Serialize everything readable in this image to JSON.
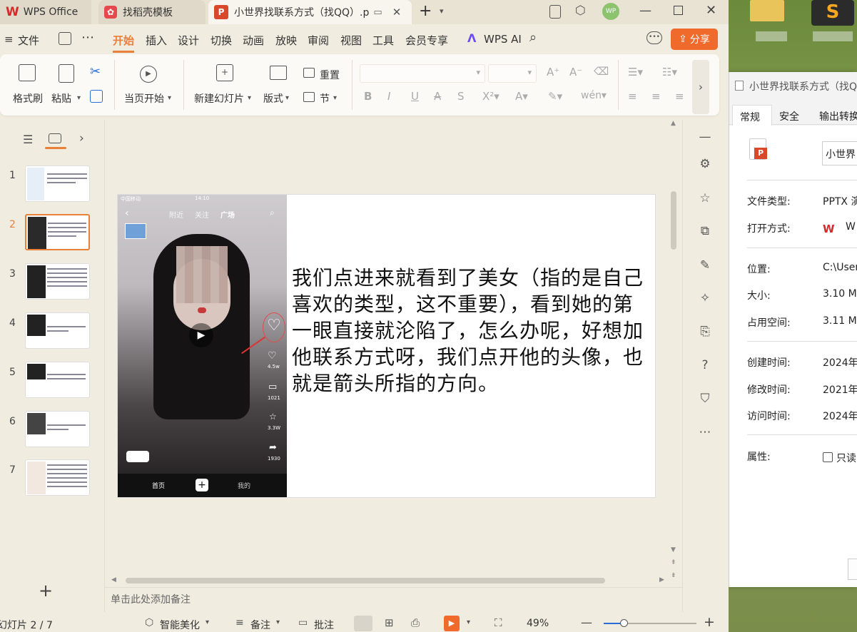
{
  "tabs": [
    {
      "label": "WPS Office"
    },
    {
      "label": "找稻壳模板"
    },
    {
      "label": "小世界找联系方式（找QQ）.p"
    }
  ],
  "window_controls": {
    "avatar": "WP"
  },
  "menu": {
    "file": "文件",
    "items": [
      "开始",
      "插入",
      "设计",
      "切换",
      "动画",
      "放映",
      "审阅",
      "视图",
      "工具",
      "会员专享"
    ],
    "active": "开始",
    "wps_ai": "WPS AI",
    "share": "分享"
  },
  "ribbon": {
    "format_painter": "格式刷",
    "paste": "粘贴",
    "play_from_current": "当页开始",
    "new_slide": "新建幻灯片",
    "layout": "版式",
    "reset": "重置",
    "section": "节"
  },
  "slides_panel": {
    "numbers": [
      "1",
      "2",
      "3",
      "4",
      "5",
      "6",
      "7"
    ],
    "selected": "2"
  },
  "slide": {
    "text": "我们点进来就看到了美女（指的是自己喜欢的类型，这不重要），看到她的第一眼直接就沦陷了，怎么办呢，好想加他联系方式呀，我们点开他的头像，也就是箭头所指的方向。",
    "phone": {
      "carrier": "中国移动",
      "time": "14:10",
      "tab_nearby": "附近",
      "tab_follow": "关注",
      "tab_square": "广场",
      "like_count": "4.5w",
      "comment_count": "1021",
      "star_count": "3.3W",
      "share_count": "1930",
      "nav_home": "首页",
      "nav_me": "我的"
    }
  },
  "notes_placeholder": "单击此处添加备注",
  "status": {
    "slide_info": "幻灯片 2 / 7",
    "smart_beautify": "智能美化",
    "notes": "备注",
    "comments": "批注",
    "zoom": "49%"
  },
  "properties": {
    "title": "小世界找联系方式（找QQ",
    "tab_general": "常规",
    "tab_security": "安全",
    "tab_export": "输出转换",
    "filename": "小世界",
    "type_label": "文件类型:",
    "type_value": "PPTX 演",
    "open_label": "打开方式:",
    "open_value": "W",
    "location_label": "位置:",
    "location_value": "C:\\User",
    "size_label": "大小:",
    "size_value": "3.10 M",
    "disk_label": "占用空间:",
    "disk_value": "3.11 M",
    "created_label": "创建时间:",
    "created_value": "2024年",
    "modified_label": "修改时间:",
    "modified_value": "2021年",
    "accessed_label": "访问时间:",
    "accessed_value": "2024年",
    "attr_label": "属性:",
    "readonly_label": "只读"
  },
  "colors": {
    "accent": "#e8803a",
    "wps_red": "#d42a2a",
    "share_btn": "#f06a2c"
  }
}
